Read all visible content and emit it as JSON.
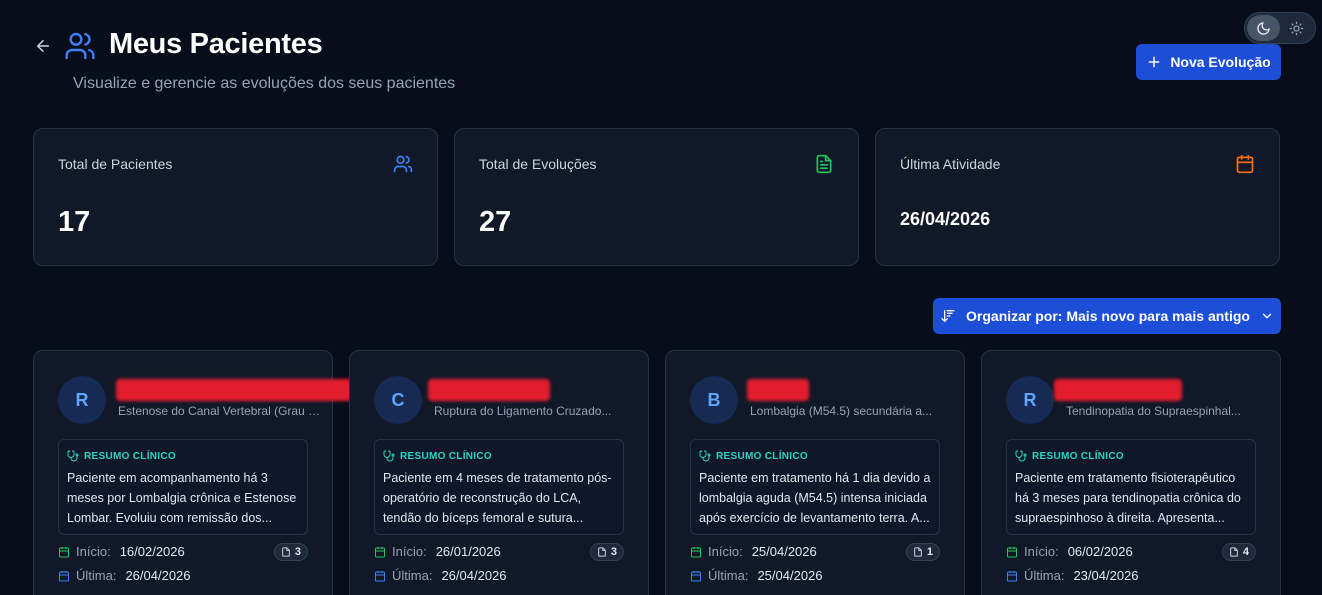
{
  "header": {
    "title": "Meus Pacientes",
    "subtitle": "Visualize e gerencie as evoluções dos seus pacientes",
    "new_button_label": "Nova Evolução"
  },
  "theme_toggle": {
    "active": "dark",
    "icons": [
      "moon-icon",
      "sun-icon"
    ]
  },
  "stats": [
    {
      "label": "Total de Pacientes",
      "value": "17",
      "icon": "users-icon",
      "color": "#3b82f6"
    },
    {
      "label": "Total de Evoluções",
      "value": "27",
      "icon": "file-text-icon",
      "color": "#22c55e"
    },
    {
      "label": "Última Atividade",
      "value": "26/04/2026",
      "icon": "calendar-icon",
      "color": "#f97316"
    }
  ],
  "sort": {
    "label": "Organizar por: Mais novo para mais antigo"
  },
  "summary_heading": "RESUMO CLÍNICO",
  "date_labels": {
    "start": "Início:",
    "last": "Última:"
  },
  "patients": [
    {
      "initial": "R",
      "diagnosis": "Estenose do Canal Vertebral (Grau I-II)",
      "summary": "Paciente em acompanhamento há 3 meses por Lombalgia crônica e Estenose Lombar. Evoluiu com remissão dos...",
      "start": "16/02/2026",
      "last": "26/04/2026",
      "count": "3"
    },
    {
      "initial": "C",
      "diagnosis": "Ruptura do Ligamento Cruzado...",
      "summary": "Paciente em 4 meses de tratamento pós-operatório de reconstrução do LCA, tendão do bíceps femoral e sutura...",
      "start": "26/01/2026",
      "last": "26/04/2026",
      "count": "3"
    },
    {
      "initial": "B",
      "diagnosis": "Lombalgia (M54.5) secundária a...",
      "summary": "Paciente em tratamento há 1 dia devido a lombalgia aguda (M54.5) intensa iniciada após exercício de levantamento terra. A...",
      "start": "25/04/2026",
      "last": "25/04/2026",
      "count": "1"
    },
    {
      "initial": "R",
      "diagnosis": "Tendinopatia do Supraespinhal...",
      "summary": "Paciente em tratamento fisioterapêutico há 3 meses para tendinopatia crônica do supraespinhoso à direita. Apresenta...",
      "start": "06/02/2026",
      "last": "23/04/2026",
      "count": "4"
    }
  ]
}
